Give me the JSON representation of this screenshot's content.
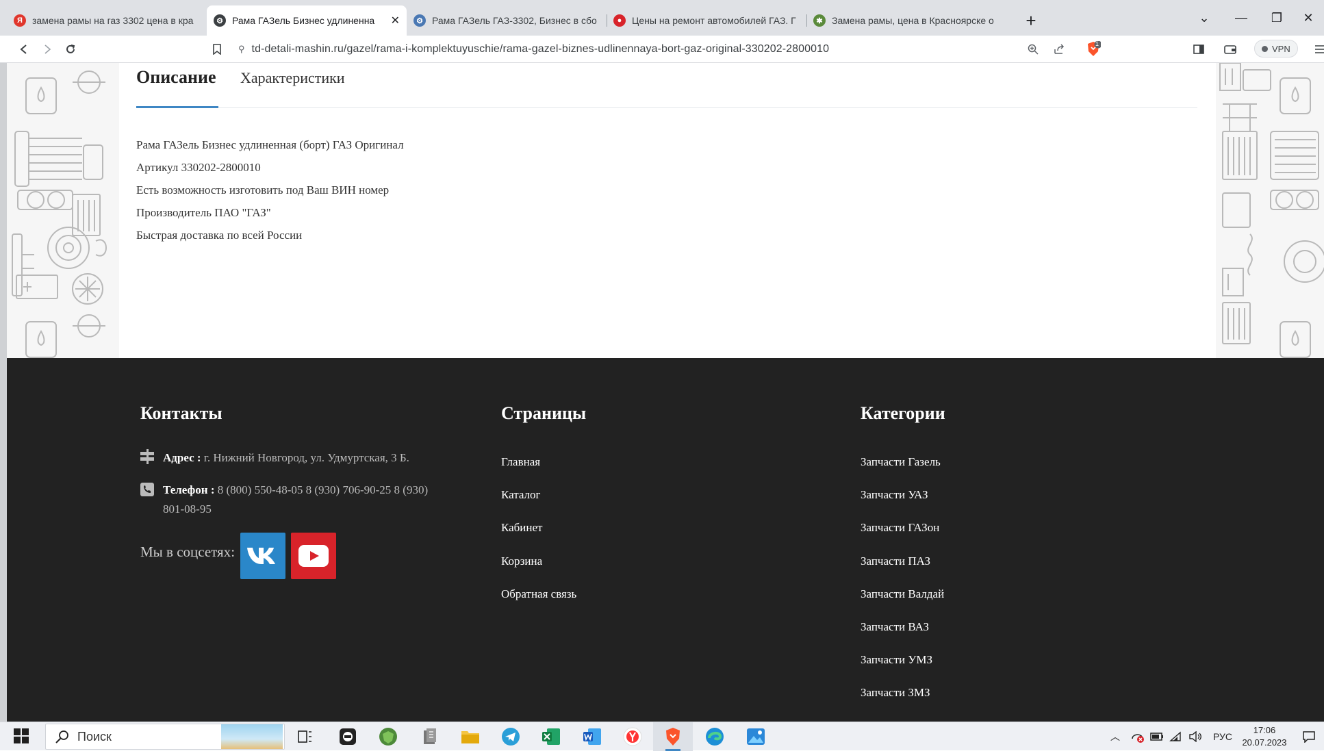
{
  "browser": {
    "tabs": [
      {
        "title": "замена рамы на газ 3302 цена в кра",
        "favicon": "yandex-icon",
        "color": "#e0362c",
        "active": false
      },
      {
        "title": "Рама ГАЗель Бизнес удлиненна",
        "favicon": "gear-site-icon",
        "color": "#3c4043",
        "active": true
      },
      {
        "title": "Рама ГАЗель ГАЗ-3302, Бизнес в сбо",
        "favicon": "gear-site-icon",
        "color": "#4a78b3",
        "active": false
      },
      {
        "title": "Цены на ремонт автомобилей ГАЗ. Г",
        "favicon": "red-circle-icon",
        "color": "#d8232a",
        "active": false
      },
      {
        "title": "Замена рамы, цена в Красноярске о",
        "favicon": "wrench-site-icon",
        "color": "#5a8a3a",
        "active": false
      }
    ],
    "url": "td-detali-mashin.ru/gazel/rama-i-komplektuyuschie/rama-gazel-biznes-udlinennaya-bort-gaz-original-330202-2800010",
    "vpn_label": "VPN",
    "brave_badge": "1"
  },
  "product_tabs": {
    "description": "Описание",
    "characteristics": "Характеристики"
  },
  "description_lines": [
    "Рама ГАЗель Бизнес удлиненная (борт) ГАЗ Оригинал",
    "Артикул 330202-2800010",
    "Есть возможность изготовить под Ваш ВИН номер",
    "Производитель ПАО \"ГАЗ\"",
    "Быстрая доставка по всей России"
  ],
  "footer": {
    "contacts": {
      "heading": "Контакты",
      "address_label": "Адрес :",
      "address_value": "г. Нижний Новгород, ул. Удмуртская, 3 Б.",
      "phone_label": "Телефон :",
      "phone_value_line1": "8 (800) 550-48-05 8 (930) 706-90-25 8 (930)",
      "phone_value_line2": "801-08-95",
      "social_label": "Мы в соцсетях:"
    },
    "pages": {
      "heading": "Страницы",
      "links": [
        "Главная",
        "Каталог",
        "Кабинет",
        "Корзина",
        "Обратная связь"
      ]
    },
    "categories": {
      "heading": "Категории",
      "links": [
        "Запчасти Газель",
        "Запчасти УАЗ",
        "Запчасти ГАЗон",
        "Запчасти ПАЗ",
        "Запчасти Валдай",
        "Запчасти ВАЗ",
        "Запчасти УМЗ",
        "Запчасти ЗМЗ"
      ]
    }
  },
  "taskbar": {
    "search_placeholder": "Поиск",
    "language": "РУС",
    "time": "17:06",
    "date": "20.07.2023"
  },
  "colors": {
    "accent": "#3f87c4",
    "footer_bg": "#222222",
    "vk": "#2a87c9",
    "youtube": "#d8232a"
  }
}
